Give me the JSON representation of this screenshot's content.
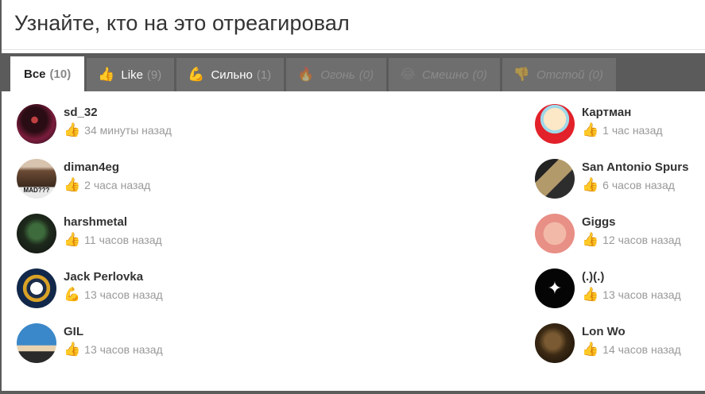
{
  "dialog": {
    "title": "Узнайте, кто на это отреагировал"
  },
  "tabs": [
    {
      "label": "Все",
      "count": "(10)",
      "icon": "",
      "state": "active"
    },
    {
      "label": "Like",
      "count": "(9)",
      "icon": "thumbs-up-icon",
      "state": "normal"
    },
    {
      "label": "Сильно",
      "count": "(1)",
      "icon": "flexed-biceps-icon",
      "state": "normal"
    },
    {
      "label": "Огонь",
      "count": "(0)",
      "icon": "fire-icon",
      "state": "disabled"
    },
    {
      "label": "Смешно",
      "count": "(0)",
      "icon": "laughing-face-icon",
      "state": "disabled"
    },
    {
      "label": "Отстой",
      "count": "(0)",
      "icon": "thumbs-down-icon",
      "state": "disabled"
    }
  ],
  "reactions_left": [
    {
      "name": "sd_32",
      "reaction": "thumbs-up-icon",
      "time": "34 минуты назад"
    },
    {
      "name": "diman4eg",
      "reaction": "thumbs-up-icon",
      "time": "2 часа назад"
    },
    {
      "name": "harshmetal",
      "reaction": "thumbs-up-icon",
      "time": "11 часов назад"
    },
    {
      "name": "Jack Perlovka",
      "reaction": "flexed-biceps-icon",
      "time": "13 часов назад"
    },
    {
      "name": "GIL",
      "reaction": "thumbs-up-icon",
      "time": "13 часов назад"
    }
  ],
  "reactions_right": [
    {
      "name": "Картман",
      "reaction": "thumbs-up-icon",
      "time": "1 час назад"
    },
    {
      "name": "San Antonio Spurs",
      "reaction": "thumbs-up-icon",
      "time": "6 часов назад"
    },
    {
      "name": "Giggs",
      "reaction": "thumbs-up-icon",
      "time": "12 часов назад"
    },
    {
      "name": "(.)(.)",
      "reaction": "thumbs-up-icon",
      "time": "13 часов назад"
    },
    {
      "name": "Lon Wo",
      "reaction": "thumbs-up-icon",
      "time": "14 часов назад"
    }
  ],
  "colors": {
    "tab_bar": "#5b5b5b",
    "tab_inactive": "#6e6e6e",
    "muted_text": "#999999"
  }
}
